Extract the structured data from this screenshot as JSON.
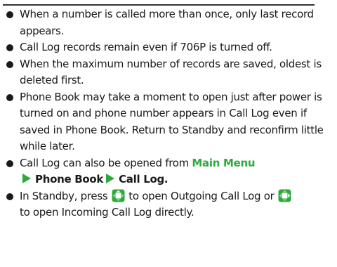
{
  "notes": [
    {
      "text": "When a number is called more than once, only last record appears."
    },
    {
      "text": "Call Log records remain even if 706P is turned off."
    },
    {
      "text": "When the maximum number of records are saved, oldest is deleted first."
    },
    {
      "text": "Phone Book may take a moment to open just after power is turned on and phone number appears in Call Log even if saved in Phone Book. Return to Standby and reconfirm little while later."
    },
    {
      "prefix": "Call Log can also be opened from ",
      "menu": "Main Menu",
      "path1": "Phone Book",
      "path2": "Call Log",
      "suffix": "."
    },
    {
      "part1": "In Standby, press ",
      "part2": " to open Outgoing Call Log or ",
      "part3": " to open Incoming Call Log directly.",
      "key1_icon": "nav-key-up-icon",
      "key2_icon": "nav-key-right-icon"
    }
  ],
  "colors": {
    "accent": "#2eaa3c",
    "text": "#1a1a1a"
  }
}
